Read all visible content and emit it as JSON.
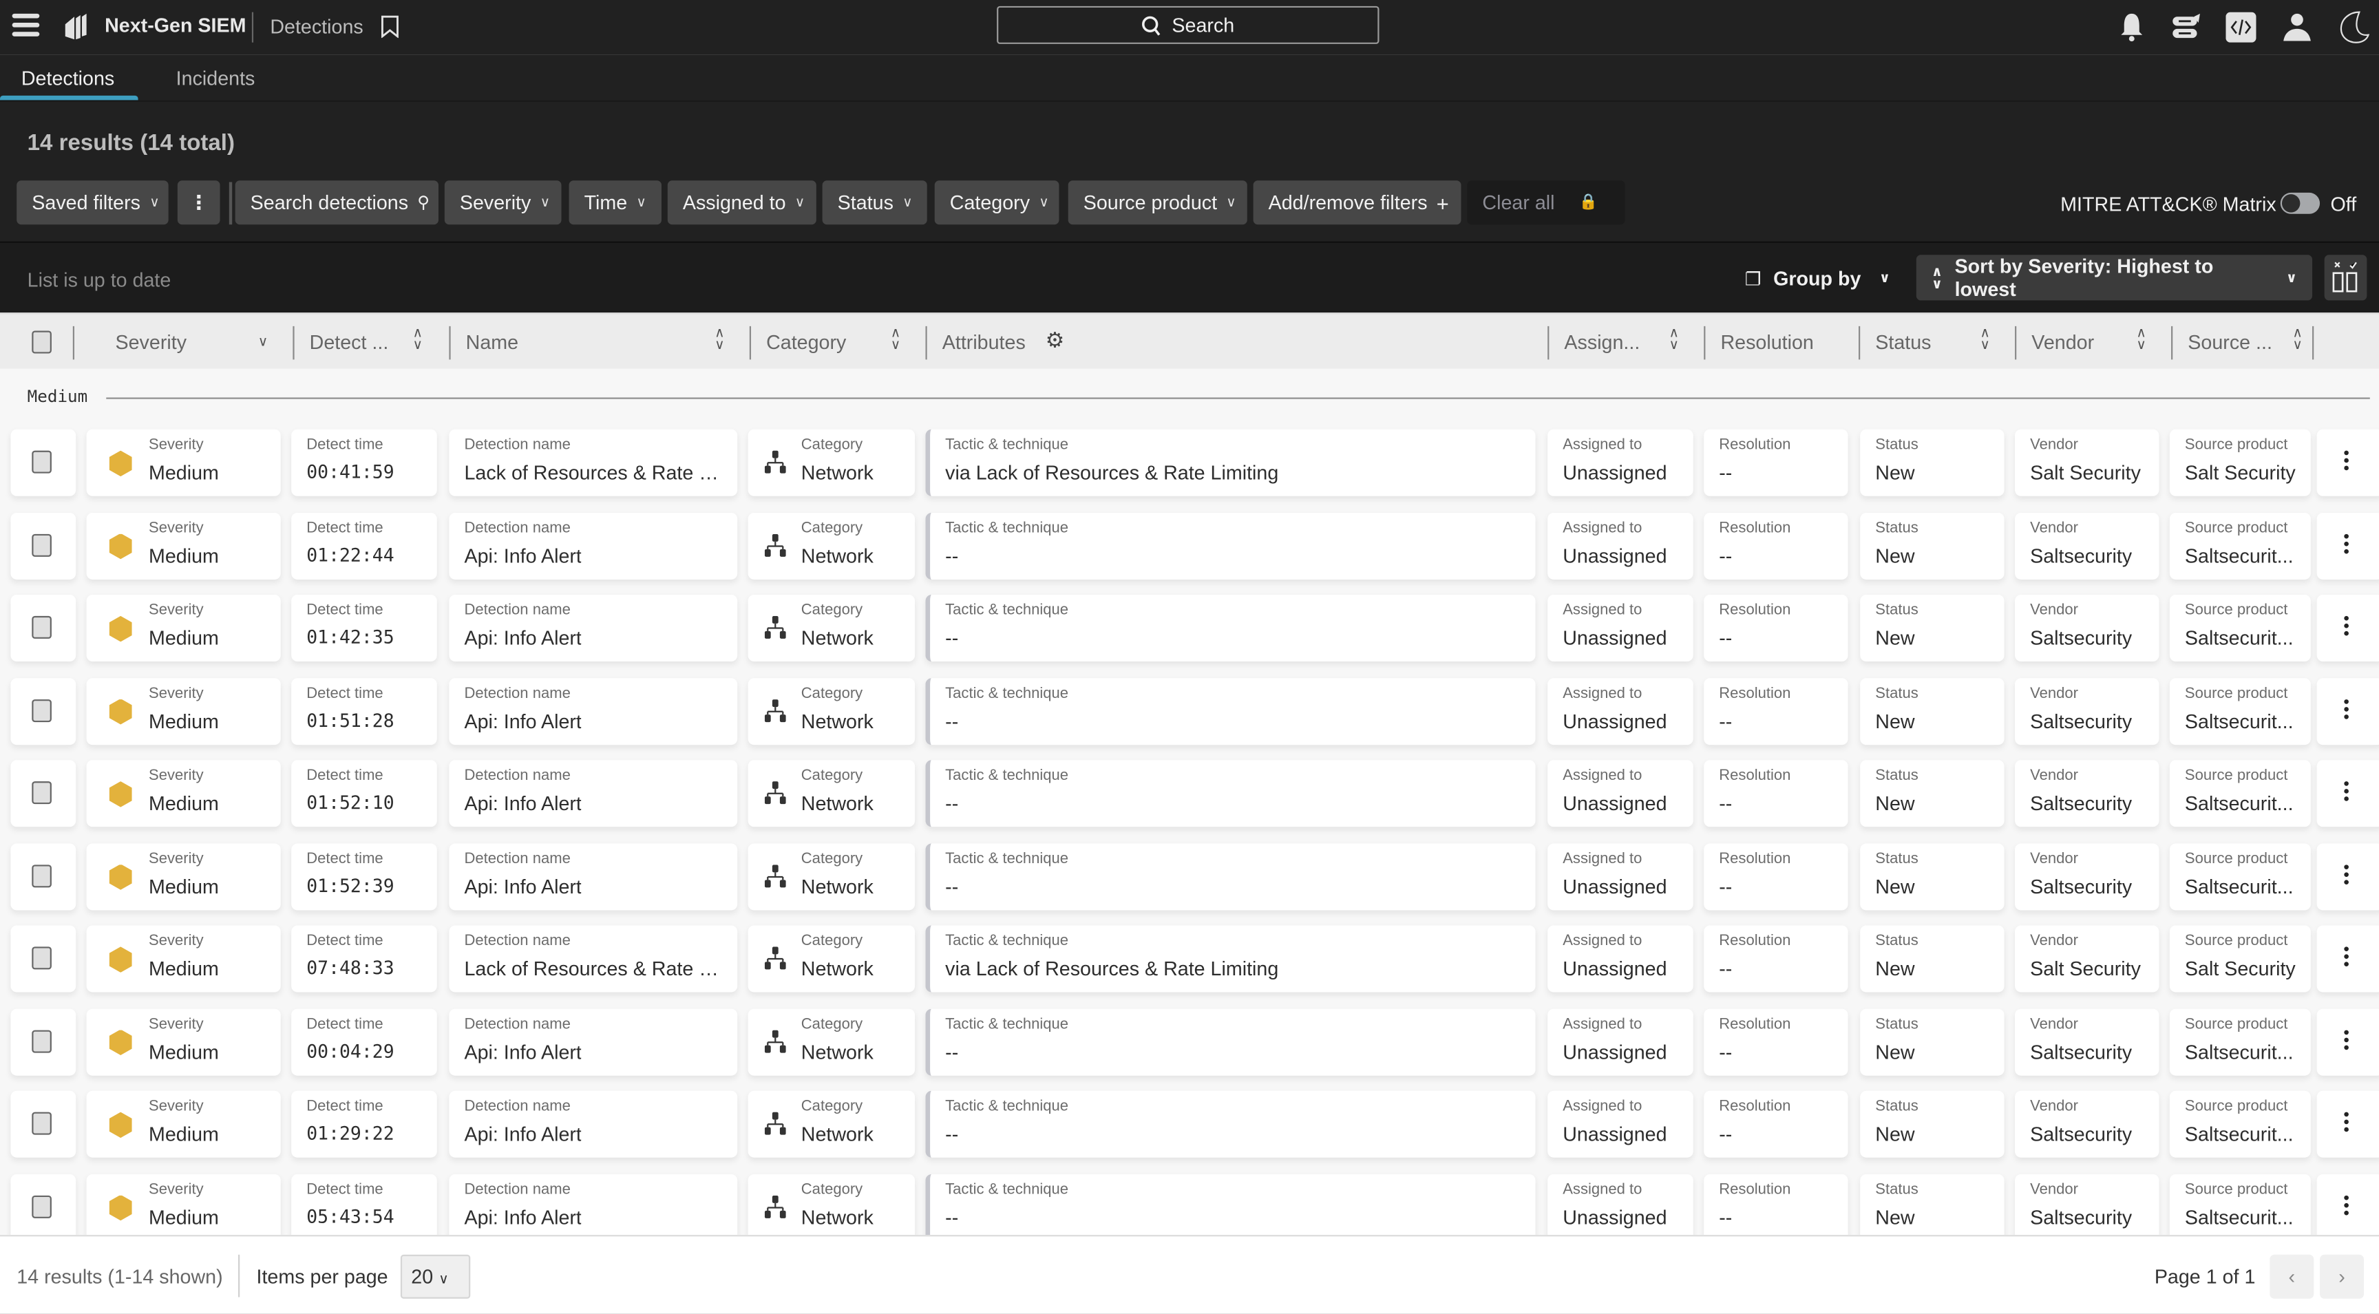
{
  "app": {
    "title": "Next-Gen SIEM",
    "breadcrumb": "Detections",
    "search_label": "Search"
  },
  "icons": {
    "menu": "hamburger-icon",
    "logo": "falcon-logo-icon",
    "bookmark": "bookmark-icon",
    "search": "search-icon",
    "bell": "bell-icon",
    "messages": "messages-icon",
    "code": "code-icon",
    "user": "user-icon",
    "theme": "moon-icon"
  },
  "tabs": [
    {
      "label": "Detections",
      "active": true
    },
    {
      "label": "Incidents",
      "active": false
    }
  ],
  "summary": "14 results (14 total)",
  "filters": {
    "saved_filters": "Saved filters",
    "search_detections": "Search detections",
    "severity": "Severity",
    "time": "Time",
    "assigned_to": "Assigned to",
    "status": "Status",
    "category": "Category",
    "source_product": "Source product",
    "add_remove": "Add/remove filters",
    "clear_all": "Clear all",
    "mitre_label": "MITRE ATT&CK® Matrix",
    "mitre_state": "Off"
  },
  "listbar": {
    "status": "List is up to date",
    "group_by": "Group by",
    "sort_by": "Sort by Severity: Highest to lowest"
  },
  "columns": {
    "severity": "Severity",
    "detect": "Detect ...",
    "name": "Name",
    "category": "Category",
    "attributes": "Attributes",
    "assign": "Assign...",
    "resolution": "Resolution",
    "status": "Status",
    "vendor": "Vendor",
    "source": "Source ..."
  },
  "card_labels": {
    "severity": "Severity",
    "detect_time": "Detect time",
    "detection_name": "Detection name",
    "category": "Category",
    "tactic": "Tactic & technique",
    "assigned": "Assigned to",
    "resolution": "Resolution",
    "status": "Status",
    "vendor": "Vendor",
    "source_product": "Source product"
  },
  "group": "Medium",
  "severity_color": "#e3b23c",
  "accent": "#3d9ebf",
  "rows": [
    {
      "severity": "Medium",
      "time": "00:41:59",
      "name": "Lack of Resources & Rate Li...",
      "category": "Network",
      "tactic": "via Lack of Resources & Rate Limiting",
      "assigned": "Unassigned",
      "resolution": "--",
      "status": "New",
      "vendor": "Salt Security",
      "source": "Salt Security"
    },
    {
      "severity": "Medium",
      "time": "01:22:44",
      "name": "Api: Info Alert",
      "category": "Network",
      "tactic": "--",
      "assigned": "Unassigned",
      "resolution": "--",
      "status": "New",
      "vendor": "Saltsecurity",
      "source": "Saltsecurit..."
    },
    {
      "severity": "Medium",
      "time": "01:42:35",
      "name": "Api: Info Alert",
      "category": "Network",
      "tactic": "--",
      "assigned": "Unassigned",
      "resolution": "--",
      "status": "New",
      "vendor": "Saltsecurity",
      "source": "Saltsecurit..."
    },
    {
      "severity": "Medium",
      "time": "01:51:28",
      "name": "Api: Info Alert",
      "category": "Network",
      "tactic": "--",
      "assigned": "Unassigned",
      "resolution": "--",
      "status": "New",
      "vendor": "Saltsecurity",
      "source": "Saltsecurit..."
    },
    {
      "severity": "Medium",
      "time": "01:52:10",
      "name": "Api: Info Alert",
      "category": "Network",
      "tactic": "--",
      "assigned": "Unassigned",
      "resolution": "--",
      "status": "New",
      "vendor": "Saltsecurity",
      "source": "Saltsecurit..."
    },
    {
      "severity": "Medium",
      "time": "01:52:39",
      "name": "Api: Info Alert",
      "category": "Network",
      "tactic": "--",
      "assigned": "Unassigned",
      "resolution": "--",
      "status": "New",
      "vendor": "Saltsecurity",
      "source": "Saltsecurit..."
    },
    {
      "severity": "Medium",
      "time": "07:48:33",
      "name": "Lack of Resources & Rate Li...",
      "category": "Network",
      "tactic": "via Lack of Resources & Rate Limiting",
      "assigned": "Unassigned",
      "resolution": "--",
      "status": "New",
      "vendor": "Salt Security",
      "source": "Salt Security"
    },
    {
      "severity": "Medium",
      "time": "00:04:29",
      "name": "Api: Info Alert",
      "category": "Network",
      "tactic": "--",
      "assigned": "Unassigned",
      "resolution": "--",
      "status": "New",
      "vendor": "Saltsecurity",
      "source": "Saltsecurit..."
    },
    {
      "severity": "Medium",
      "time": "01:29:22",
      "name": "Api: Info Alert",
      "category": "Network",
      "tactic": "--",
      "assigned": "Unassigned",
      "resolution": "--",
      "status": "New",
      "vendor": "Saltsecurity",
      "source": "Saltsecurit..."
    },
    {
      "severity": "Medium",
      "time": "05:43:54",
      "name": "Api: Info Alert",
      "category": "Network",
      "tactic": "--",
      "assigned": "Unassigned",
      "resolution": "--",
      "status": "New",
      "vendor": "Saltsecurity",
      "source": "Saltsecurit..."
    }
  ],
  "footer": {
    "results": "14 results (1-14 shown)",
    "items_per_page_label": "Items per page",
    "items_per_page": "20",
    "page": "Page 1 of 1"
  }
}
